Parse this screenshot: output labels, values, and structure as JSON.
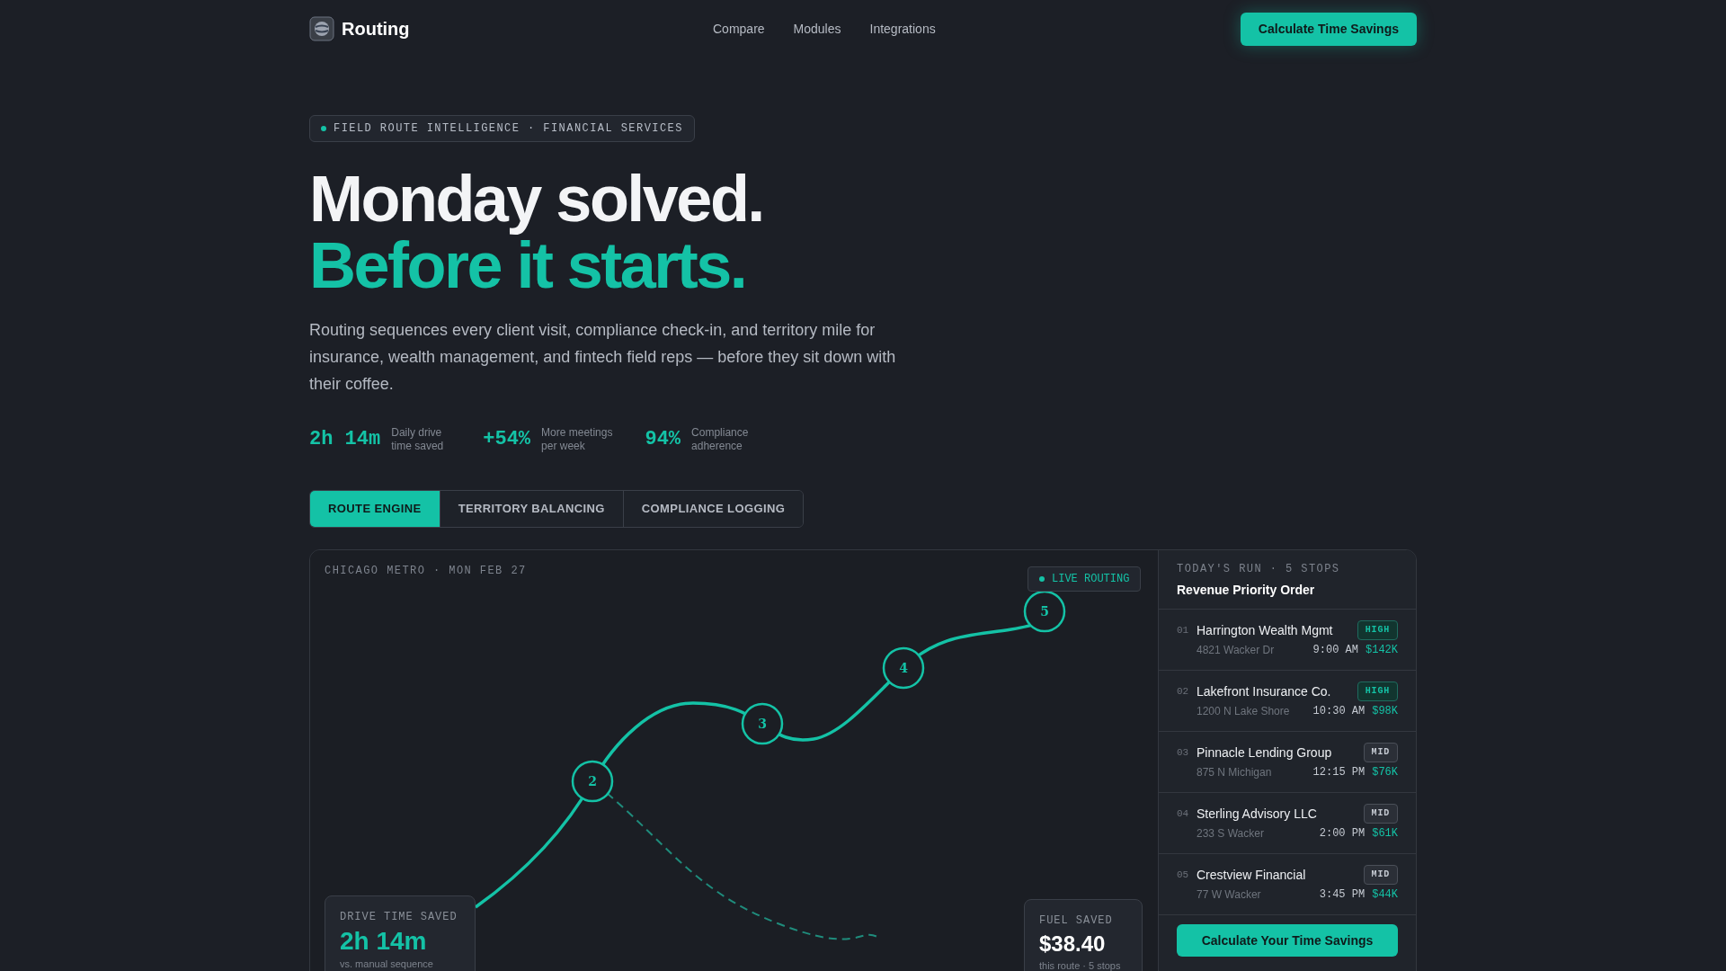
{
  "brand": {
    "name": "Routing"
  },
  "nav": [
    "Compare",
    "Modules",
    "Integrations"
  ],
  "header_cta": "Calculate Time Savings",
  "eyebrow": "FIELD ROUTE INTELLIGENCE · FINANCIAL SERVICES",
  "headline": {
    "line_1": "Monday solved.",
    "line_2": "Before it starts."
  },
  "intro": "Routing sequences every client visit, compliance check-in, and territory mile for insurance, wealth management, and fintech field reps — before they sit down with their coffee.",
  "stats": [
    {
      "value": "2h 14m",
      "label_1": "Daily drive",
      "label_2": "time saved"
    },
    {
      "value": "+54%",
      "label_1": "More meetings",
      "label_2": "per week"
    },
    {
      "value": "94%",
      "label_1": "Compliance",
      "label_2": "adherence"
    }
  ],
  "tabs": [
    {
      "label": "ROUTE ENGINE",
      "selected": true
    },
    {
      "label": "TERRITORY BALANCING",
      "selected": false
    },
    {
      "label": "COMPLIANCE LOGGING",
      "selected": false
    }
  ],
  "map": {
    "caption": "CHICAGO METRO · MON FEB 27",
    "live_badge": "LIVE ROUTING",
    "nodes": [
      "2",
      "3",
      "4",
      "5"
    ],
    "drive_card": {
      "label": "DRIVE TIME SAVED",
      "value": "2h 14m",
      "note": "vs. manual sequence"
    },
    "fuel_card": {
      "label": "FUEL SAVED",
      "value": "$38.40",
      "note": "this route · 5 stops"
    }
  },
  "run": {
    "eyebrow": "TODAY'S RUN · 5 STOPS",
    "title": "Revenue Priority Order",
    "stops": [
      {
        "number": "01",
        "name": "Harrington Wealth Mgmt",
        "kind": "high",
        "badge": "HIGH",
        "address": "4821 Wacker Dr",
        "time": "9:00 AM",
        "value": "$142K"
      },
      {
        "number": "02",
        "name": "Lakefront Insurance Co.",
        "kind": "high",
        "badge": "HIGH",
        "address": "1200 N Lake Shore",
        "time": "10:30 AM",
        "value": "$98K"
      },
      {
        "number": "03",
        "name": "Pinnacle Lending Group",
        "kind": "mid",
        "badge": "MID",
        "address": "875 N Michigan",
        "time": "12:15 PM",
        "value": "$76K"
      },
      {
        "number": "04",
        "name": "Sterling Advisory LLC",
        "kind": "mid",
        "badge": "MID",
        "address": "233 S Wacker",
        "time": "2:00 PM",
        "value": "$61K"
      },
      {
        "number": "05",
        "name": "Crestview Financial",
        "kind": "mid",
        "badge": "MID",
        "address": "77 W Wacker",
        "time": "3:45 PM",
        "value": "$44K"
      }
    ],
    "cta": "Calculate Your Time Savings"
  }
}
